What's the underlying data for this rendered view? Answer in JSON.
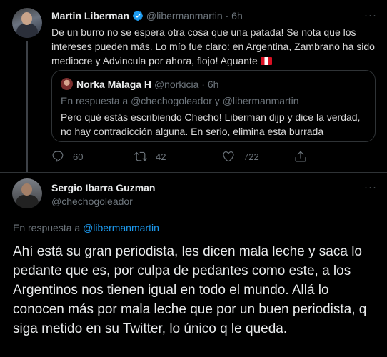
{
  "tweet1": {
    "author_name": "Martin Liberman",
    "handle": "@libermanmartin",
    "time": "6h",
    "more_label": "···",
    "text": "De un burro no se espera otra cosa que una patada! Se nota que los intereses pueden más. Lo mío fue claro: en Argentina, Zambrano ha sido mediocre y Advincula por ahora, flojo! Aguante",
    "quote": {
      "author_name": "Norka Málaga H",
      "handle": "@norkicia",
      "time": "6h",
      "reply_prefix": "En respuesta a",
      "reply_to": "@chechogoleador y @libermanmartin",
      "text": "Pero qué estás escribiendo Checho! Liberman dijp y dice la verdad, no hay contradicción alguna. En serio, elimina esta burrada"
    },
    "actions": {
      "replies": "60",
      "retweets": "42",
      "likes": "722"
    }
  },
  "tweet2": {
    "author_name": "Sergio Ibarra Guzman",
    "handle": "@chechogoleador",
    "more_label": "···",
    "reply_prefix": "En respuesta a",
    "reply_to": "@libermanmartin",
    "text": "Ahí está su gran periodista, les dicen mala leche y saca lo pedante que es, por culpa de pedantes como este, a los Argentinos nos tienen igual en todo el mundo. Allá lo conocen más por mala leche que por un buen periodista, q siga metido en su Twitter, lo único q le queda."
  },
  "colors": {
    "background": "#000000",
    "text": "#d9d9d9",
    "muted": "#6e767d",
    "link": "#1d9bf0",
    "verified": "#1d9bf0",
    "border": "#2f3336",
    "flag_red": "#d91023"
  },
  "icons": [
    "verified-badge-icon",
    "reply-icon",
    "retweet-icon",
    "like-icon",
    "share-icon",
    "more-icon",
    "peru-flag-icon"
  ]
}
